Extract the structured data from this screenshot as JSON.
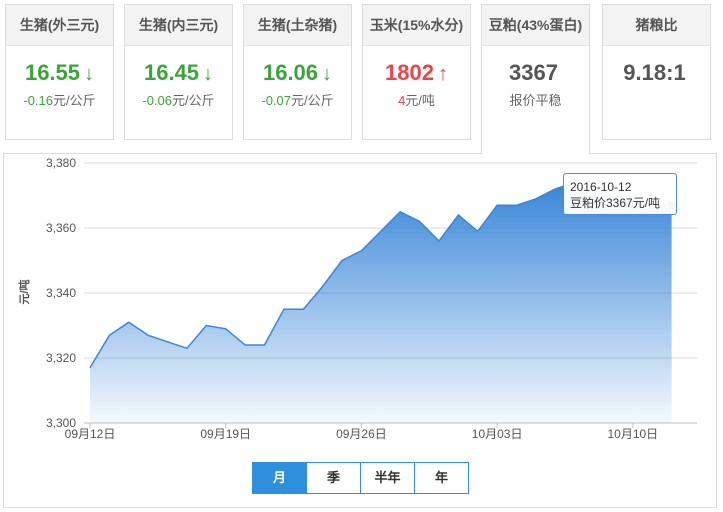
{
  "cards": [
    {
      "title": "生猪(外三元)",
      "value": "16.55",
      "arrow": "↓",
      "trend": "down",
      "change_num": "-0.16",
      "change_unit": "元/公斤"
    },
    {
      "title": "生猪(内三元)",
      "value": "16.45",
      "arrow": "↓",
      "trend": "down",
      "change_num": "-0.06",
      "change_unit": "元/公斤"
    },
    {
      "title": "生猪(土杂猪)",
      "value": "16.06",
      "arrow": "↓",
      "trend": "down",
      "change_num": "-0.07",
      "change_unit": "元/公斤"
    },
    {
      "title": "玉米(15%水分)",
      "value": "1802",
      "arrow": "↑",
      "trend": "up",
      "change_num": "4",
      "change_unit": "元/吨"
    },
    {
      "title": "豆粕(43%蛋白)",
      "value": "3367",
      "arrow": "",
      "trend": "flat",
      "change_num": "",
      "change_unit": "报价平稳"
    },
    {
      "title": "猪粮比",
      "value": "9.18:1",
      "arrow": "",
      "trend": "flat",
      "change_num": "",
      "change_unit": ""
    }
  ],
  "colors": {
    "down": "#3aa53a",
    "up": "#ee4444",
    "accent": "#2f8fdc"
  },
  "tooltip": {
    "date": "2016-10-12",
    "text": "豆粕价3367元/吨"
  },
  "range_tabs": [
    {
      "label": "月",
      "active": true
    },
    {
      "label": "季",
      "active": false
    },
    {
      "label": "半年",
      "active": false
    },
    {
      "label": "年",
      "active": false
    }
  ],
  "chart_data": {
    "type": "area",
    "ylabel": "元/吨",
    "ylim": [
      3300,
      3380
    ],
    "yticks": [
      3300,
      3320,
      3340,
      3360,
      3380
    ],
    "ytick_labels": [
      "3,300",
      "3,320",
      "3,340",
      "3,360",
      "3,380"
    ],
    "xlim_days": [
      0,
      31
    ],
    "xticks": [
      {
        "label": "09月12日",
        "day": 0
      },
      {
        "label": "09月19日",
        "day": 7
      },
      {
        "label": "09月26日",
        "day": 14
      },
      {
        "label": "10月03日",
        "day": 21
      },
      {
        "label": "10月10日",
        "day": 28
      }
    ],
    "grid": true,
    "series": [
      {
        "name": "豆粕价",
        "points": [
          {
            "x": "09月12日",
            "y": 3317
          },
          {
            "x": "09月13日",
            "y": 3327
          },
          {
            "x": "09月14日",
            "y": 3331
          },
          {
            "x": "09月15日",
            "y": 3327
          },
          {
            "x": "09月16日",
            "y": 3325
          },
          {
            "x": "09月17日",
            "y": 3323
          },
          {
            "x": "09月18日",
            "y": 3330
          },
          {
            "x": "09月19日",
            "y": 3329
          },
          {
            "x": "09月20日",
            "y": 3324
          },
          {
            "x": "09月21日",
            "y": 3324
          },
          {
            "x": "09月22日",
            "y": 3335
          },
          {
            "x": "09月23日",
            "y": 3335
          },
          {
            "x": "09月24日",
            "y": 3342
          },
          {
            "x": "09月25日",
            "y": 3350
          },
          {
            "x": "09月26日",
            "y": 3353
          },
          {
            "x": "09月27日",
            "y": 3359
          },
          {
            "x": "09月28日",
            "y": 3365
          },
          {
            "x": "09月29日",
            "y": 3362
          },
          {
            "x": "09月30日",
            "y": 3356
          },
          {
            "x": "10月01日",
            "y": 3364
          },
          {
            "x": "10月02日",
            "y": 3359
          },
          {
            "x": "10月03日",
            "y": 3367
          },
          {
            "x": "10月04日",
            "y": 3367
          },
          {
            "x": "10月05日",
            "y": 3369
          },
          {
            "x": "10月06日",
            "y": 3372
          },
          {
            "x": "10月07日",
            "y": 3374
          },
          {
            "x": "10月08日",
            "y": 3370
          },
          {
            "x": "10月09日",
            "y": 3369
          },
          {
            "x": "10月10日",
            "y": 3368
          },
          {
            "x": "10月11日",
            "y": 3367
          },
          {
            "x": "10月12日",
            "y": 3367
          }
        ]
      }
    ]
  }
}
